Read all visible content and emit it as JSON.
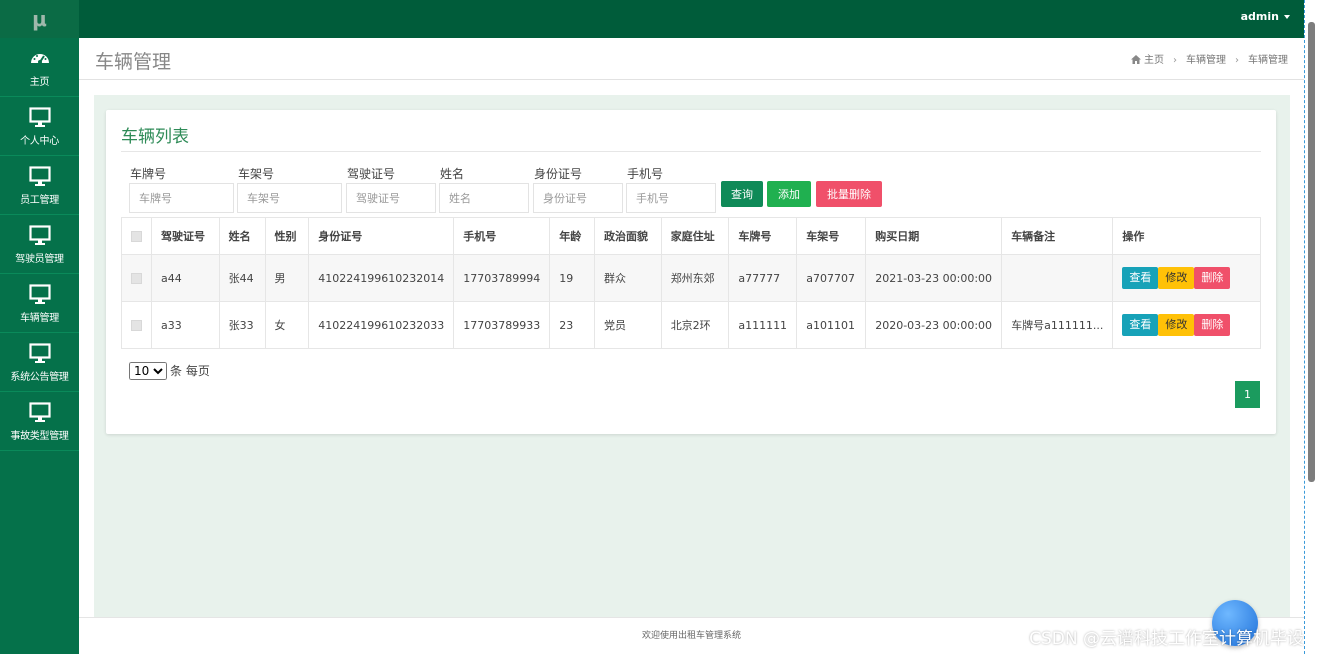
{
  "app": {
    "logo_text": "μ",
    "user_label": "admin"
  },
  "colors": {
    "topbar": "#005c3a",
    "sidebar": "#05714a",
    "accent": "#2e8b57",
    "query": "#0f8a58",
    "add": "#20b050",
    "danger": "#f0506a",
    "view": "#17a2b8",
    "edit": "#ffc107"
  },
  "sidebar": {
    "items": [
      {
        "label": "主页",
        "icon": "dashboard-icon"
      },
      {
        "label": "个人中心",
        "icon": "monitor-icon"
      },
      {
        "label": "员工管理",
        "icon": "monitor-icon"
      },
      {
        "label": "驾驶员管理",
        "icon": "monitor-icon"
      },
      {
        "label": "车辆管理",
        "icon": "monitor-icon"
      },
      {
        "label": "系统公告管理",
        "icon": "monitor-icon"
      },
      {
        "label": "事故类型管理",
        "icon": "monitor-icon"
      }
    ]
  },
  "header": {
    "title": "车辆管理",
    "breadcrumb": [
      "主页",
      "车辆管理",
      "车辆管理"
    ],
    "breadcrumb_icon": "home-icon"
  },
  "panel": {
    "title": "车辆列表"
  },
  "search": {
    "fields": [
      {
        "label": "车牌号",
        "placeholder": "车牌号"
      },
      {
        "label": "车架号",
        "placeholder": "车架号"
      },
      {
        "label": "驾驶证号",
        "placeholder": "驾驶证号"
      },
      {
        "label": "姓名",
        "placeholder": "姓名"
      },
      {
        "label": "身份证号",
        "placeholder": "身份证号"
      },
      {
        "label": "手机号",
        "placeholder": "手机号"
      }
    ],
    "query_label": "查询",
    "add_label": "添加",
    "batch_delete_label": "批量删除"
  },
  "table": {
    "headers": [
      "驾驶证号",
      "姓名",
      "性别",
      "身份证号",
      "手机号",
      "年龄",
      "政治面貌",
      "家庭住址",
      "车牌号",
      "车架号",
      "购买日期",
      "车辆备注",
      "操作"
    ],
    "rows": [
      {
        "cells": [
          "a44",
          "张44",
          "男",
          "410224199610232014",
          "17703789994",
          "19",
          "群众",
          "郑州东郊",
          "a77777",
          "a707707",
          "2021-03-23 00:00:00",
          ""
        ]
      },
      {
        "cells": [
          "a33",
          "张33",
          "女",
          "410224199610232033",
          "17703789933",
          "23",
          "党员",
          "北京2环",
          "a111111",
          "a101101",
          "2020-03-23 00:00:00",
          "车牌号a111111..."
        ]
      }
    ],
    "actions": {
      "view": "查看",
      "edit": "修改",
      "delete": "删除"
    }
  },
  "pagination": {
    "page_size": "10",
    "page_size_options": [
      "10"
    ],
    "page_size_suffix": "条 每页",
    "current_page": "1"
  },
  "footer": {
    "text": "欢迎使用出租车管理系统"
  },
  "watermark": "CSDN @云谱科技工作室计算机毕设"
}
